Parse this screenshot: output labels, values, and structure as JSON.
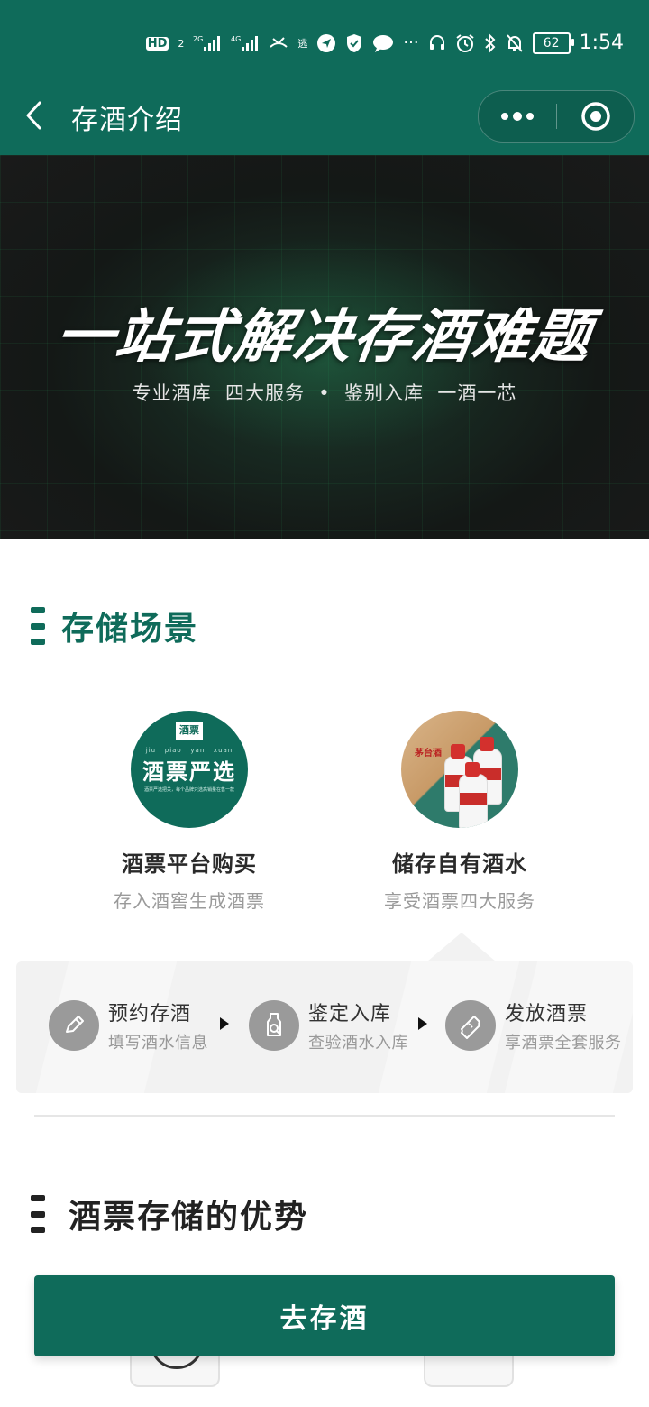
{
  "status_bar": {
    "hd_label": "HD",
    "sim_index": "2",
    "network1": "2G",
    "network2": "4G",
    "battery": "62",
    "time": "1:54"
  },
  "nav": {
    "title": "存酒介绍",
    "more_label": "•••"
  },
  "hero": {
    "title": "一站式解决存酒难题",
    "subtitle": "专业酒库  四大服务  •  鉴别入库  一酒一芯"
  },
  "sections": {
    "storage_title": "存储场景",
    "advantages_title": "酒票存储的优势"
  },
  "scenarios": [
    {
      "title": "酒票平台购买",
      "subtitle": "存入酒窖生成酒票",
      "image_tag": "酒票",
      "image_pinyin": "jiu   piao   yan   xuan",
      "image_text": "酒票严选",
      "image_small": "酒票严选把关，每个品牌只选高销量在售一款"
    },
    {
      "title": "储存自有酒水",
      "subtitle": "享受酒票四大服务",
      "image_label": "茅台酒"
    }
  ],
  "steps": [
    {
      "title": "预约存酒",
      "subtitle": "填写酒水信息",
      "icon": "pencil-icon"
    },
    {
      "title": "鉴定入库",
      "subtitle": "查验酒水入库",
      "icon": "bottle-search-icon"
    },
    {
      "title": "发放酒票",
      "subtitle": "享酒票全套服务",
      "icon": "ticket-icon"
    }
  ],
  "cta": {
    "label": "去存酒"
  },
  "colors": {
    "brand": "#0f6b5a",
    "hero_bg": "#1a1a1a",
    "panel_bg": "#f2f2f2"
  }
}
